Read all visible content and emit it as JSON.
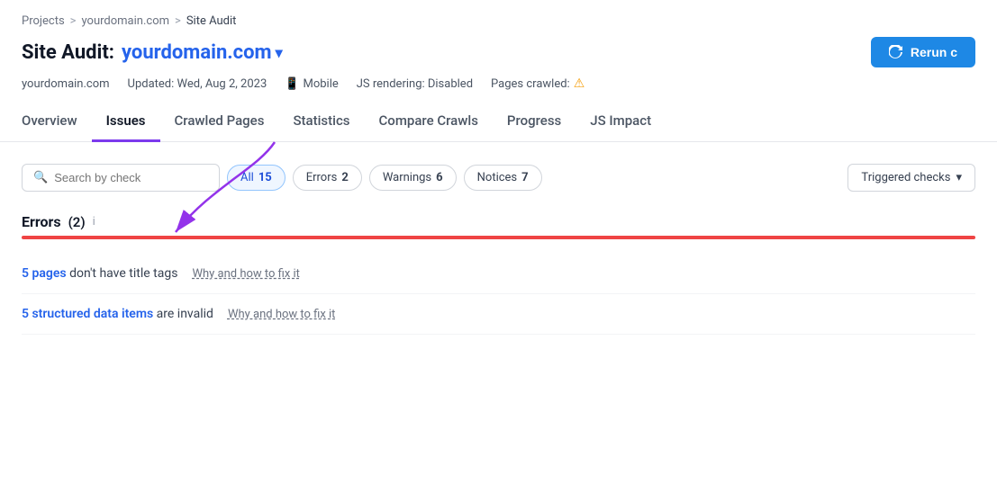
{
  "breadcrumb": {
    "projects": "Projects",
    "separator1": ">",
    "domain": "yourdomain.com",
    "separator2": ">",
    "current": "Site Audit"
  },
  "page": {
    "title_static": "Site Audit:",
    "domain": "yourdomain.com",
    "rerun_label": "Rerun c"
  },
  "meta": {
    "domain": "yourdomain.com",
    "updated_label": "Updated: Wed, Aug 2, 2023",
    "device_label": "Mobile",
    "js_rendering": "JS rendering: Disabled",
    "pages_crawled_label": "Pages crawled:"
  },
  "nav": {
    "tabs": [
      {
        "id": "overview",
        "label": "Overview",
        "active": false
      },
      {
        "id": "issues",
        "label": "Issues",
        "active": true
      },
      {
        "id": "crawled-pages",
        "label": "Crawled Pages",
        "active": false
      },
      {
        "id": "statistics",
        "label": "Statistics",
        "active": false
      },
      {
        "id": "compare-crawls",
        "label": "Compare Crawls",
        "active": false
      },
      {
        "id": "progress",
        "label": "Progress",
        "active": false
      },
      {
        "id": "js-impact",
        "label": "JS Impact",
        "active": false
      }
    ]
  },
  "filters": {
    "search_placeholder": "Search by check",
    "all_label": "All",
    "all_count": "15",
    "errors_label": "Errors",
    "errors_count": "2",
    "warnings_label": "Warnings",
    "warnings_count": "6",
    "notices_label": "Notices",
    "notices_count": "7",
    "triggered_label": "Triggered checks"
  },
  "errors_section": {
    "title": "Errors",
    "count": "(2)",
    "info_icon": "i"
  },
  "issues": [
    {
      "id": "issue-1",
      "count_text": "5 pages",
      "description": " don't have title tags",
      "fix_label": "Why and how to fix it"
    },
    {
      "id": "issue-2",
      "count_text": "5 structured data items",
      "description": " are invalid",
      "fix_label": "Why and how to fix it"
    }
  ]
}
